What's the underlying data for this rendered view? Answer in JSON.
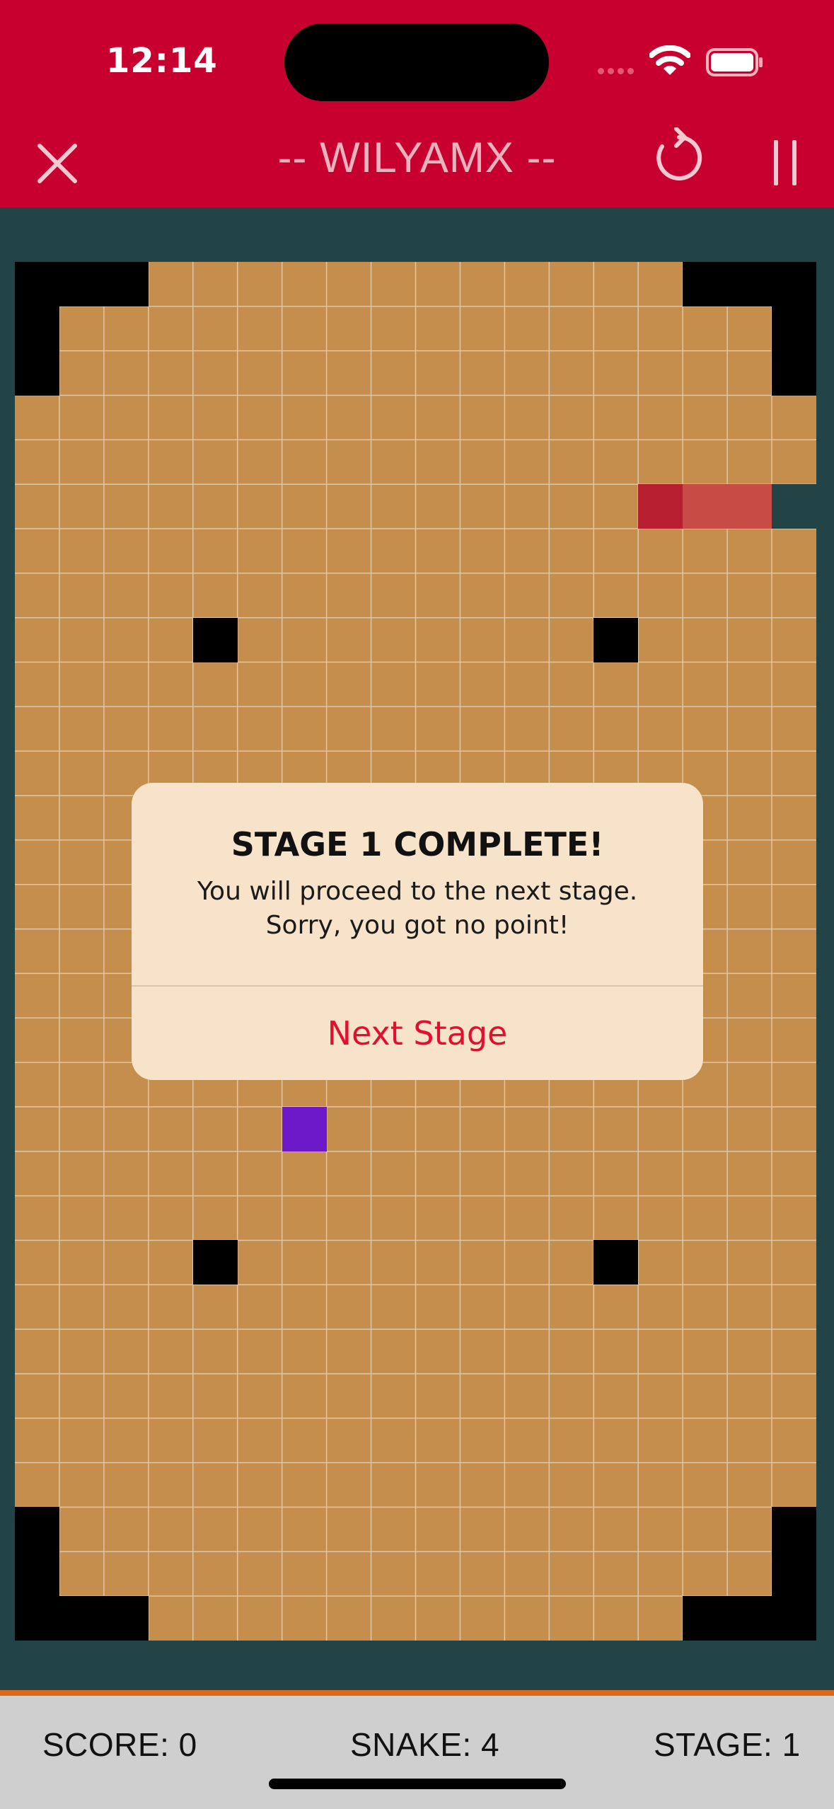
{
  "status_bar": {
    "time": "12:14"
  },
  "nav": {
    "title": "-- WILYAMX --",
    "close_icon": "close-icon",
    "restart_icon": "restart-icon",
    "pause_icon": "pause-icon"
  },
  "colors": {
    "top_bar": "#c8002f",
    "background": "#234446",
    "board": "#c68e4c",
    "wall": "#000000",
    "snake_head": "#b71f31",
    "snake_body": "#c74c45",
    "snake_tail": "#234446",
    "food": "#6c1ac9",
    "accent": "#e0102f"
  },
  "game": {
    "grid_cols": 18,
    "grid_rows": 31,
    "walls": [
      [
        0,
        0
      ],
      [
        1,
        0
      ],
      [
        2,
        0
      ],
      [
        15,
        0
      ],
      [
        16,
        0
      ],
      [
        17,
        0
      ],
      [
        0,
        1
      ],
      [
        17,
        1
      ],
      [
        0,
        2
      ],
      [
        17,
        2
      ],
      [
        4,
        8
      ],
      [
        13,
        8
      ],
      [
        4,
        22
      ],
      [
        13,
        22
      ],
      [
        0,
        28
      ],
      [
        17,
        28
      ],
      [
        0,
        29
      ],
      [
        17,
        29
      ],
      [
        0,
        30
      ],
      [
        1,
        30
      ],
      [
        2,
        30
      ],
      [
        15,
        30
      ],
      [
        16,
        30
      ],
      [
        17,
        30
      ]
    ],
    "snake": [
      [
        14,
        5
      ],
      [
        15,
        5
      ],
      [
        16,
        5
      ],
      [
        17,
        5
      ]
    ],
    "food": [
      6,
      19
    ]
  },
  "dialog": {
    "title": "STAGE 1 COMPLETE!",
    "message_lines": [
      "You will proceed to the next stage.",
      "Sorry, you got no point!"
    ],
    "button": "Next Stage"
  },
  "hud": {
    "score": "SCORE: 0",
    "snake": "SNAKE: 4",
    "stage": "STAGE: 1"
  }
}
